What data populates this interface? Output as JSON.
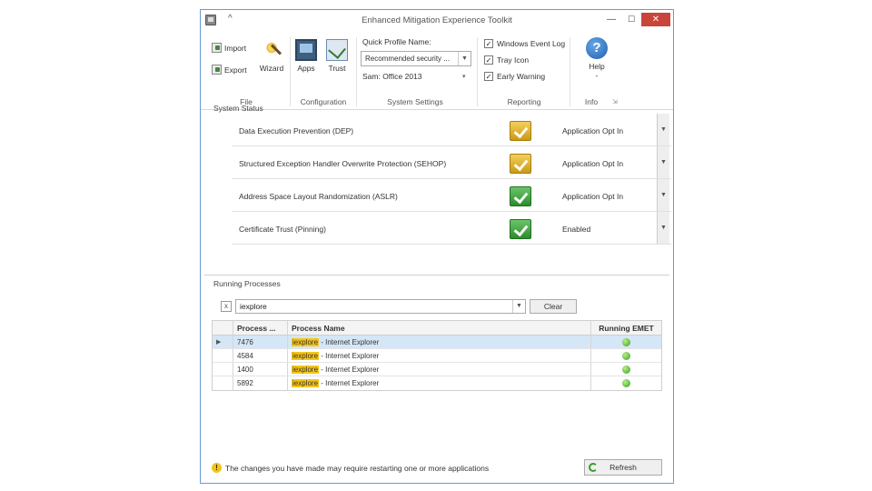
{
  "window": {
    "title": "Enhanced Mitigation Experience Toolkit",
    "toggle": "^",
    "min": "—",
    "max": "☐",
    "close": "✕"
  },
  "ribbon": {
    "file": {
      "import": "Import",
      "export": "Export",
      "wizard": "Wizard",
      "group": "File"
    },
    "configuration": {
      "apps": "Apps",
      "trust": "Trust",
      "group": "Configuration"
    },
    "system_settings": {
      "quick_profile_label": "Quick Profile Name:",
      "quick_profile_value": "Recommended security ...",
      "subprofile": "Sam: Office 2013",
      "group": "System Settings"
    },
    "reporting": {
      "windows_event_log": "Windows Event Log",
      "tray_icon": "Tray Icon",
      "early_warning": "Early Warning",
      "group": "Reporting"
    },
    "info": {
      "help": "Help",
      "help_dd": "-",
      "group": "Info",
      "launcher": "⇲"
    }
  },
  "system_status": {
    "label": "System Status",
    "rows": [
      {
        "name": "Data Execution Prevention (DEP)",
        "value": "Application Opt In",
        "state": "yellow"
      },
      {
        "name": "Structured Exception Handler Overwrite Protection (SEHOP)",
        "value": "Application Opt In",
        "state": "yellow"
      },
      {
        "name": "Address Space Layout Randomization (ASLR)",
        "value": "Application Opt In",
        "state": "green"
      },
      {
        "name": "Certificate Trust (Pinning)",
        "value": "Enabled",
        "state": "green"
      }
    ]
  },
  "running_processes": {
    "label": "Running Processes",
    "filter_x": "x",
    "filter_value": "iexplore",
    "clear": "Clear",
    "columns": {
      "pid": "Process ...",
      "name": "Process Name",
      "emet": "Running EMET"
    },
    "sort_glyph": "▲",
    "rows": [
      {
        "pid": "7476",
        "match": "iexplore",
        "rest": " - Internet Explorer",
        "pointer": "▶"
      },
      {
        "pid": "4584",
        "match": "iexplore",
        "rest": " - Internet Explorer",
        "pointer": ""
      },
      {
        "pid": "1400",
        "match": "iexplore",
        "rest": " - Internet Explorer",
        "pointer": ""
      },
      {
        "pid": "5892",
        "match": "iexplore",
        "rest": " - Internet Explorer",
        "pointer": ""
      }
    ]
  },
  "footer": {
    "warning": "The changes you have made may require restarting one or more applications",
    "refresh": "Refresh"
  },
  "colors": {
    "accent": "#6b9bd1",
    "close": "#c9453a",
    "highlight": "#f5c518",
    "selected_row": "#d5e6f6"
  }
}
